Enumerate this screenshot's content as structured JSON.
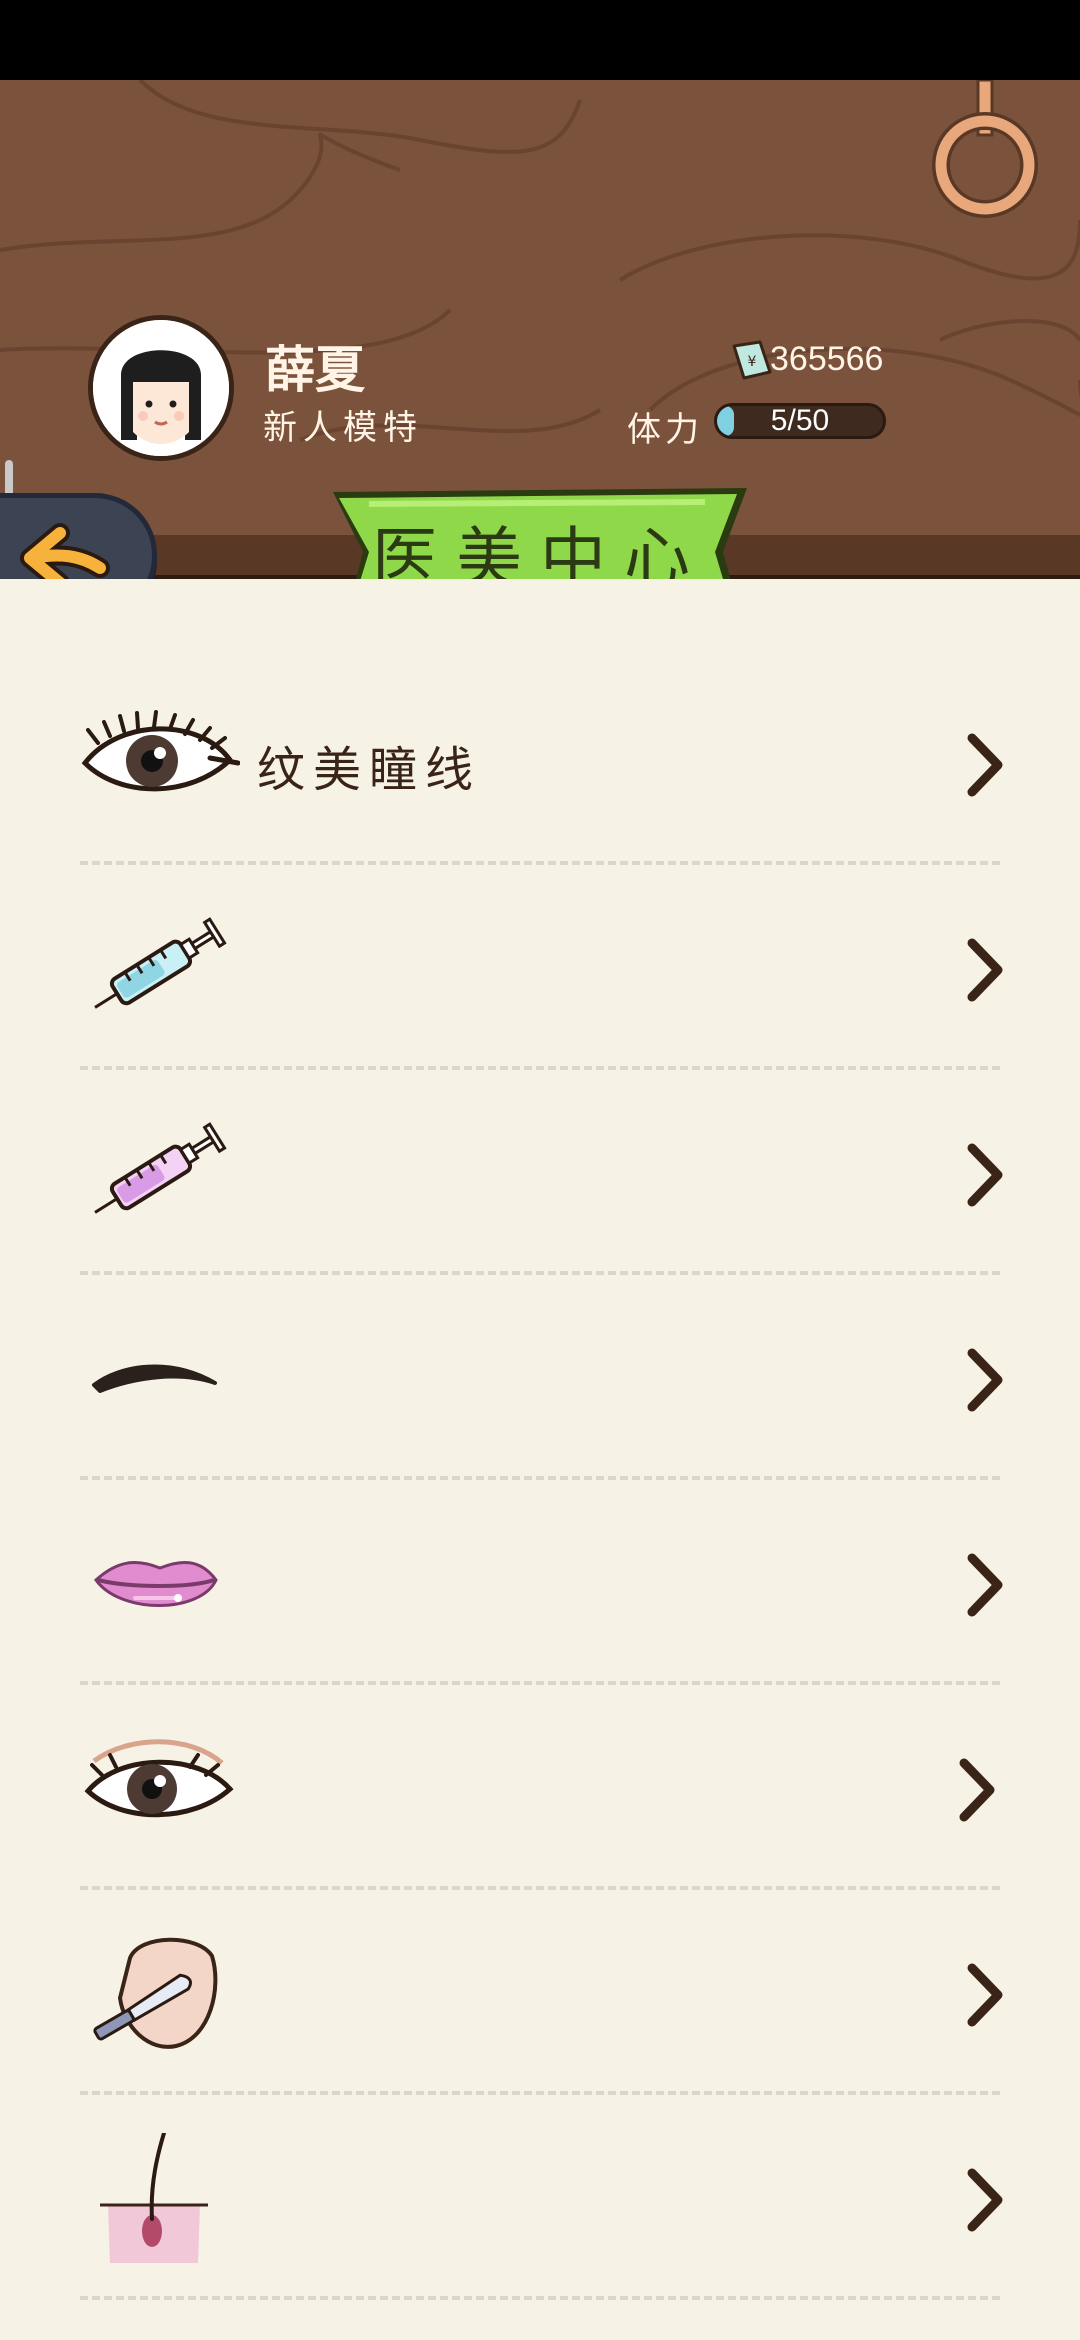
{
  "player": {
    "name": "薛夏",
    "title": "新人模特",
    "money": "365566",
    "stamina_label": "体力",
    "stamina_text": "5/50",
    "stamina_fraction": 0.1
  },
  "page": {
    "title": "医美中心"
  },
  "menu": [
    {
      "label": "纹美瞳线",
      "icon": "eye-liner-icon"
    },
    {
      "label": "",
      "icon": "syringe-blue-icon"
    },
    {
      "label": "",
      "icon": "syringe-pink-icon"
    },
    {
      "label": "",
      "icon": "eyebrow-icon"
    },
    {
      "label": "",
      "icon": "lips-icon"
    },
    {
      "label": "",
      "icon": "double-eyelid-icon"
    },
    {
      "label": "",
      "icon": "face-scalpel-icon"
    },
    {
      "label": "",
      "icon": "hair-removal-icon"
    }
  ],
  "colors": {
    "header_wood": "#7b523b",
    "banner_green": "#8fd84a",
    "content_bg": "#f7f2e6",
    "stamina_fill": "#7fd0e0"
  }
}
